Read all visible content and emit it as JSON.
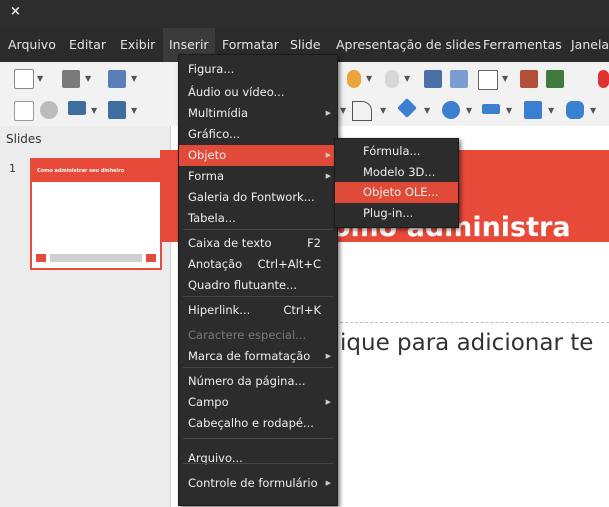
{
  "titlebar": {
    "close_glyph": "×",
    "close_icon": "close-icon"
  },
  "menubar": {
    "items": [
      "Arquivo",
      "Editar",
      "Exibir",
      "Inserir",
      "Formatar",
      "Slide",
      "Apresentação de slides",
      "Ferramentas",
      "Janela"
    ],
    "active": "Inserir"
  },
  "toolbar": {
    "row1_icons": [
      "new-document-icon",
      "open-icon",
      "save-icon",
      "undo-icon",
      "redo-icon",
      "clear-format-icon",
      "spellcheck-icon",
      "table-icon",
      "image-icon",
      "chart-icon"
    ],
    "row2_icons": [
      "select-icon",
      "zoom-icon",
      "line-color-icon",
      "fill-color-icon",
      "curve-icon",
      "shapes-icon",
      "smiley-icon",
      "arrows-icon",
      "flowchart-icon",
      "callout-icon"
    ]
  },
  "slides_panel": {
    "header": "Slides",
    "slides": [
      {
        "number": "1",
        "title": "Como administrar seu dinheiro"
      }
    ]
  },
  "slide": {
    "title": "omo administra",
    "subtitle": "ique para adicionar te",
    "accent_color": "#e84a3a"
  },
  "insert_menu": {
    "items": [
      {
        "label": "Figura...",
        "shortcut": "",
        "submenu": false,
        "disabled": false
      },
      {
        "label": "Áudio ou vídeo...",
        "shortcut": "",
        "submenu": false,
        "disabled": false
      },
      {
        "label": "Multimídia",
        "shortcut": "",
        "submenu": true,
        "disabled": false
      },
      {
        "label": "Gráfico...",
        "shortcut": "",
        "submenu": false,
        "disabled": false
      },
      {
        "label": "Objeto",
        "shortcut": "",
        "submenu": true,
        "disabled": false,
        "highlighted": true
      },
      {
        "label": "Forma",
        "shortcut": "",
        "submenu": true,
        "disabled": false
      },
      {
        "label": "Galeria do Fontwork...",
        "shortcut": "",
        "submenu": false,
        "disabled": false
      },
      {
        "label": "Tabela...",
        "shortcut": "",
        "submenu": false,
        "disabled": false
      },
      {
        "label": "Caixa de texto",
        "shortcut": "F2",
        "submenu": false,
        "disabled": false
      },
      {
        "label": "Anotação",
        "shortcut": "Ctrl+Alt+C",
        "submenu": false,
        "disabled": false
      },
      {
        "label": "Quadro flutuante...",
        "shortcut": "",
        "submenu": false,
        "disabled": false
      },
      {
        "label": "Hiperlink...",
        "shortcut": "Ctrl+K",
        "submenu": false,
        "disabled": false
      },
      {
        "label": "Caractere especial...",
        "shortcut": "",
        "submenu": false,
        "disabled": true
      },
      {
        "label": "Marca de formatação",
        "shortcut": "",
        "submenu": true,
        "disabled": false
      },
      {
        "label": "Número da página...",
        "shortcut": "",
        "submenu": false,
        "disabled": false
      },
      {
        "label": "Campo",
        "shortcut": "",
        "submenu": true,
        "disabled": false
      },
      {
        "label": "Cabeçalho e rodapé...",
        "shortcut": "",
        "submenu": false,
        "disabled": false
      },
      {
        "label": "Arquivo...",
        "shortcut": "",
        "submenu": false,
        "disabled": false
      },
      {
        "label": "Controle de formulário",
        "shortcut": "",
        "submenu": true,
        "disabled": false
      }
    ]
  },
  "object_submenu": {
    "items": [
      {
        "label": "Fórmula...",
        "highlighted": false
      },
      {
        "label": "Modelo 3D...",
        "highlighted": false
      },
      {
        "label": "Objeto OLE...",
        "highlighted": true
      },
      {
        "label": "Plug-in...",
        "highlighted": false
      }
    ]
  },
  "colors": {
    "menu_bg": "#2c2c2c",
    "highlight": "#e04a38",
    "menubar_bg": "#2b2b2b"
  }
}
